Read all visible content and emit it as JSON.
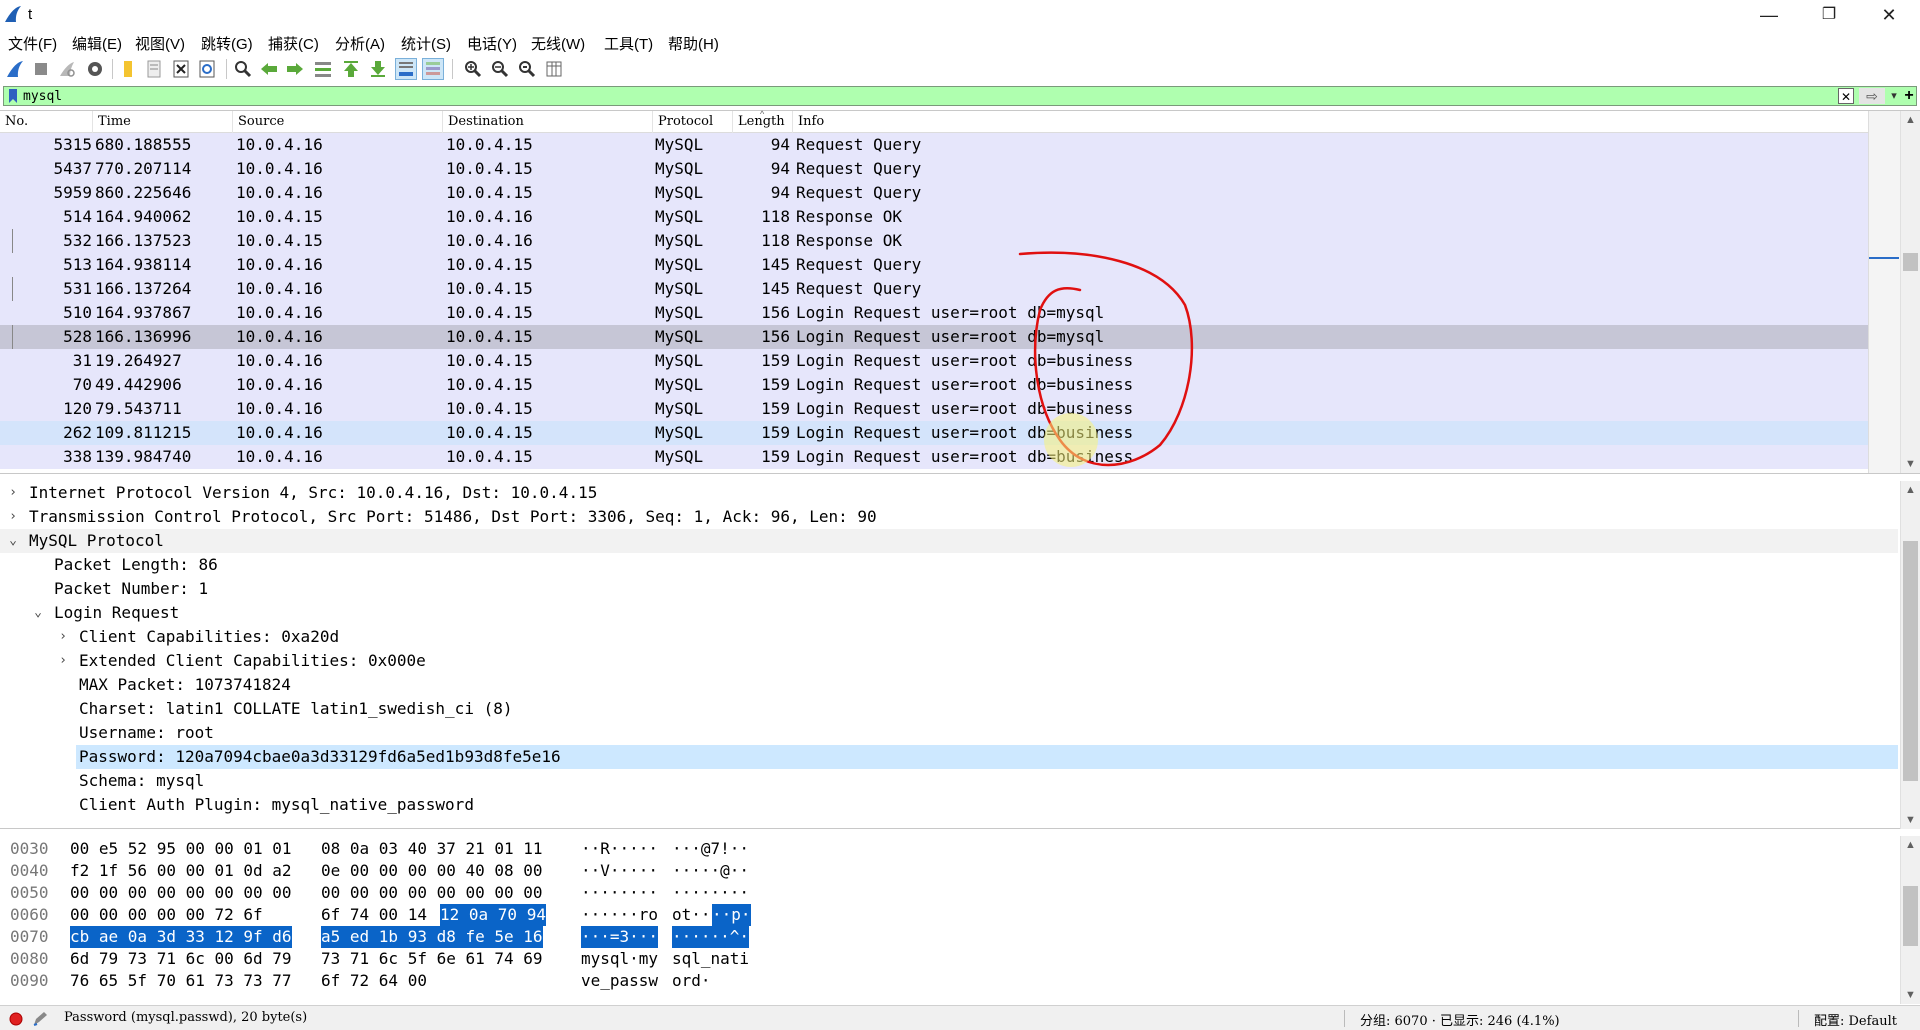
{
  "window": {
    "title": "t",
    "minimize": "—",
    "restore": "❐",
    "close": "✕"
  },
  "menu": [
    "文件(F)",
    "编辑(E)",
    "视图(V)",
    "跳转(G)",
    "捕获(C)",
    "分析(A)",
    "统计(S)",
    "电话(Y)",
    "无线(W)",
    "工具(T)",
    "帮助(H)"
  ],
  "toolbar_icons": [
    "start-capture-icon",
    "stop-capture-icon",
    "restart-capture-icon",
    "capture-options-icon",
    "open-file-icon",
    "save-file-icon",
    "close-file-icon",
    "reload-file-icon",
    "find-packet-icon",
    "go-back-icon",
    "go-forward-icon",
    "go-to-packet-icon",
    "go-first-icon",
    "go-last-icon",
    "auto-scroll-icon",
    "colorize-icon",
    "zoom-in-icon",
    "zoom-out-icon",
    "normal-size-icon",
    "resize-columns-icon"
  ],
  "filter": {
    "value": "mysql",
    "clear": "✕",
    "apply": "⇨",
    "dropdown": "▾",
    "add": "+"
  },
  "packet_list": {
    "columns": [
      "No.",
      "Time",
      "Source",
      "Destination",
      "Protocol",
      "Length",
      "Info"
    ],
    "rows": [
      {
        "no": "5315",
        "time": "680.188555",
        "src": "10.0.4.16",
        "dst": "10.0.4.15",
        "proto": "MySQL",
        "len": "94",
        "info": "Request Query"
      },
      {
        "no": "5437",
        "time": "770.207114",
        "src": "10.0.4.16",
        "dst": "10.0.4.15",
        "proto": "MySQL",
        "len": "94",
        "info": "Request Query"
      },
      {
        "no": "5959",
        "time": "860.225646",
        "src": "10.0.4.16",
        "dst": "10.0.4.15",
        "proto": "MySQL",
        "len": "94",
        "info": "Request Query"
      },
      {
        "no": "514",
        "time": "164.940062",
        "src": "10.0.4.15",
        "dst": "10.0.4.16",
        "proto": "MySQL",
        "len": "118",
        "info": "Response OK"
      },
      {
        "no": "532",
        "time": "166.137523",
        "src": "10.0.4.15",
        "dst": "10.0.4.16",
        "proto": "MySQL",
        "len": "118",
        "info": "Response OK"
      },
      {
        "no": "513",
        "time": "164.938114",
        "src": "10.0.4.16",
        "dst": "10.0.4.15",
        "proto": "MySQL",
        "len": "145",
        "info": "Request Query"
      },
      {
        "no": "531",
        "time": "166.137264",
        "src": "10.0.4.16",
        "dst": "10.0.4.15",
        "proto": "MySQL",
        "len": "145",
        "info": "Request Query"
      },
      {
        "no": "510",
        "time": "164.937867",
        "src": "10.0.4.16",
        "dst": "10.0.4.15",
        "proto": "MySQL",
        "len": "156",
        "info": "Login Request user=root db=mysql"
      },
      {
        "no": "528",
        "time": "166.136996",
        "src": "10.0.4.16",
        "dst": "10.0.4.15",
        "proto": "MySQL",
        "len": "156",
        "info": "Login Request user=root db=mysql"
      },
      {
        "no": "31",
        "time": "19.264927",
        "src": "10.0.4.16",
        "dst": "10.0.4.15",
        "proto": "MySQL",
        "len": "159",
        "info": "Login Request user=root db=business"
      },
      {
        "no": "70",
        "time": "49.442906",
        "src": "10.0.4.16",
        "dst": "10.0.4.15",
        "proto": "MySQL",
        "len": "159",
        "info": "Login Request user=root db=business"
      },
      {
        "no": "120",
        "time": "79.543711",
        "src": "10.0.4.16",
        "dst": "10.0.4.15",
        "proto": "MySQL",
        "len": "159",
        "info": "Login Request user=root db=business"
      },
      {
        "no": "262",
        "time": "109.811215",
        "src": "10.0.4.16",
        "dst": "10.0.4.15",
        "proto": "MySQL",
        "len": "159",
        "info": "Login Request user=root db=business"
      },
      {
        "no": "338",
        "time": "139.984740",
        "src": "10.0.4.16",
        "dst": "10.0.4.15",
        "proto": "MySQL",
        "len": "159",
        "info": "Login Request user=root db=business"
      }
    ]
  },
  "detail": [
    {
      "exp": "›",
      "text": "Internet Protocol Version 4, Src: 10.0.4.16, Dst: 10.0.4.15"
    },
    {
      "exp": "›",
      "text": "Transmission Control Protocol, Src Port: 51486, Dst Port: 3306, Seq: 1, Ack: 96, Len: 90"
    },
    {
      "exp": "⌄",
      "text": "MySQL Protocol"
    },
    {
      "exp": "",
      "text": "Packet Length: 86"
    },
    {
      "exp": "",
      "text": "Packet Number: 1"
    },
    {
      "exp": "⌄",
      "text": "Login Request"
    },
    {
      "exp": "›",
      "text": "Client Capabilities: 0xa20d"
    },
    {
      "exp": "›",
      "text": "Extended Client Capabilities: 0x000e"
    },
    {
      "exp": "",
      "text": "MAX Packet: 1073741824"
    },
    {
      "exp": "",
      "text": "Charset: latin1 COLLATE latin1_swedish_ci (8)"
    },
    {
      "exp": "",
      "text": "Username: root"
    },
    {
      "exp": "",
      "text": "Password: 120a7094cbae0a3d33129fd6a5ed1b93d8fe5e16"
    },
    {
      "exp": "",
      "text": "Schema: mysql"
    },
    {
      "exp": "",
      "text": "Client Auth Plugin: mysql_native_password"
    }
  ],
  "bytes": [
    {
      "off": "0030",
      "h1": "00 e5 52 95 00 00 01 01",
      "h2": "08 0a 03 40 37 21 01 11",
      "a1": "··R·····",
      "a2": "···@7!··"
    },
    {
      "off": "0040",
      "h1": "f2 1f 56 00 00 01 0d a2",
      "h2": "0e 00 00 00 00 40 08 00",
      "a1": "··V·····",
      "a2": "·····@··"
    },
    {
      "off": "0050",
      "h1": "00 00 00 00 00 00 00 00",
      "h2": "00 00 00 00 00 00 00 00",
      "a1": "········",
      "a2": "········"
    },
    {
      "off": "0060",
      "h1": "00 00 00 00 00 72 6f",
      "h1b": "6f 74 00 14",
      "h1c": "12 0a 70 94",
      "a1": "······ro",
      "a2a": "ot··",
      "a2b": "··p·"
    },
    {
      "off": "0070",
      "h1": "cb ae 0a 3d 33 12 9f d6",
      "h2": "a5 ed 1b 93 d8 fe 5e 16",
      "a1": "···=3···",
      "a2": "······^·"
    },
    {
      "off": "0080",
      "h1": "6d 79 73 71 6c 00 6d 79",
      "h2": "73 71 6c 5f 6e 61 74 69",
      "a1": "mysql·my",
      "a2": "sql_nati"
    },
    {
      "off": "0090",
      "h1": "76 65 5f 70 61 73 73 77",
      "h2": "6f 72 64 00",
      "a1": "ve_passw",
      "a2": "ord·"
    }
  ],
  "status": {
    "field": "Password (mysql.passwd), 20 byte(s)",
    "packets": "分组: 6070 · 已显示: 246 (4.1%)",
    "profile": "配置: Default"
  },
  "colors": {
    "filter_bg": "#afffaf",
    "row_bg": "#e6e6fb",
    "selected_row": "#c6c6d6",
    "byte_highlight": "#0a64c8",
    "annotation": "#e01010"
  }
}
